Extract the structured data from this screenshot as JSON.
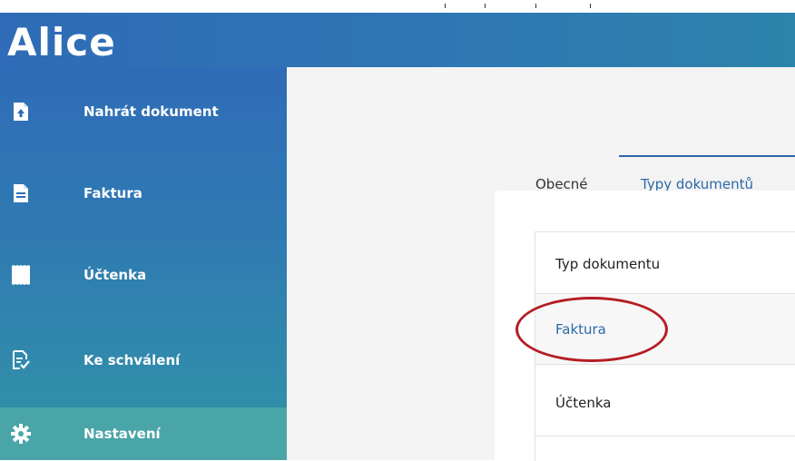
{
  "app": {
    "title": "Alice"
  },
  "sidebar": {
    "items": [
      {
        "label": "Nahrát dokument",
        "icon": "upload-file-icon"
      },
      {
        "label": "Faktura",
        "icon": "document-icon"
      },
      {
        "label": "Účtenka",
        "icon": "receipt-icon"
      },
      {
        "label": "Ke schválení",
        "icon": "approval-document-icon"
      },
      {
        "label": "Nastavení",
        "icon": "gear-icon",
        "active": true
      }
    ]
  },
  "tabs": [
    {
      "label": "Obecné"
    },
    {
      "label": "Typy dokumentů",
      "active": true
    }
  ],
  "table": {
    "header": "Typ dokumentu",
    "rows": [
      {
        "label": "Faktura",
        "highlighted": true
      },
      {
        "label": "Účtenka"
      }
    ]
  },
  "colors": {
    "accent": "#2b69a8",
    "sidebar_active": "#4aa5a8",
    "highlight_ring": "#b51d24"
  }
}
